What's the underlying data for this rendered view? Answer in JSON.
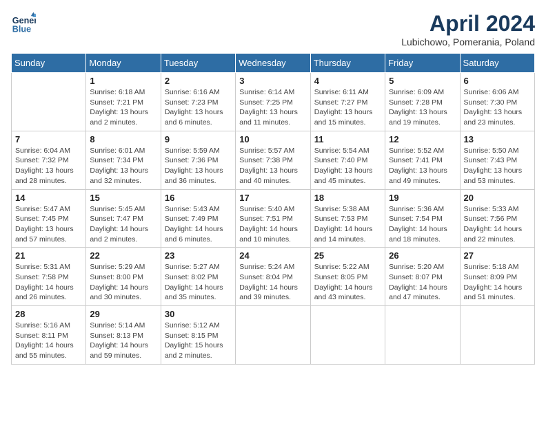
{
  "header": {
    "logo_line1": "General",
    "logo_line2": "Blue",
    "title": "April 2024",
    "location": "Lubichowo, Pomerania, Poland"
  },
  "weekdays": [
    "Sunday",
    "Monday",
    "Tuesday",
    "Wednesday",
    "Thursday",
    "Friday",
    "Saturday"
  ],
  "weeks": [
    [
      {
        "day": "",
        "info": ""
      },
      {
        "day": "1",
        "info": "Sunrise: 6:18 AM\nSunset: 7:21 PM\nDaylight: 13 hours\nand 2 minutes."
      },
      {
        "day": "2",
        "info": "Sunrise: 6:16 AM\nSunset: 7:23 PM\nDaylight: 13 hours\nand 6 minutes."
      },
      {
        "day": "3",
        "info": "Sunrise: 6:14 AM\nSunset: 7:25 PM\nDaylight: 13 hours\nand 11 minutes."
      },
      {
        "day": "4",
        "info": "Sunrise: 6:11 AM\nSunset: 7:27 PM\nDaylight: 13 hours\nand 15 minutes."
      },
      {
        "day": "5",
        "info": "Sunrise: 6:09 AM\nSunset: 7:28 PM\nDaylight: 13 hours\nand 19 minutes."
      },
      {
        "day": "6",
        "info": "Sunrise: 6:06 AM\nSunset: 7:30 PM\nDaylight: 13 hours\nand 23 minutes."
      }
    ],
    [
      {
        "day": "7",
        "info": "Sunrise: 6:04 AM\nSunset: 7:32 PM\nDaylight: 13 hours\nand 28 minutes."
      },
      {
        "day": "8",
        "info": "Sunrise: 6:01 AM\nSunset: 7:34 PM\nDaylight: 13 hours\nand 32 minutes."
      },
      {
        "day": "9",
        "info": "Sunrise: 5:59 AM\nSunset: 7:36 PM\nDaylight: 13 hours\nand 36 minutes."
      },
      {
        "day": "10",
        "info": "Sunrise: 5:57 AM\nSunset: 7:38 PM\nDaylight: 13 hours\nand 40 minutes."
      },
      {
        "day": "11",
        "info": "Sunrise: 5:54 AM\nSunset: 7:40 PM\nDaylight: 13 hours\nand 45 minutes."
      },
      {
        "day": "12",
        "info": "Sunrise: 5:52 AM\nSunset: 7:41 PM\nDaylight: 13 hours\nand 49 minutes."
      },
      {
        "day": "13",
        "info": "Sunrise: 5:50 AM\nSunset: 7:43 PM\nDaylight: 13 hours\nand 53 minutes."
      }
    ],
    [
      {
        "day": "14",
        "info": "Sunrise: 5:47 AM\nSunset: 7:45 PM\nDaylight: 13 hours\nand 57 minutes."
      },
      {
        "day": "15",
        "info": "Sunrise: 5:45 AM\nSunset: 7:47 PM\nDaylight: 14 hours\nand 2 minutes."
      },
      {
        "day": "16",
        "info": "Sunrise: 5:43 AM\nSunset: 7:49 PM\nDaylight: 14 hours\nand 6 minutes."
      },
      {
        "day": "17",
        "info": "Sunrise: 5:40 AM\nSunset: 7:51 PM\nDaylight: 14 hours\nand 10 minutes."
      },
      {
        "day": "18",
        "info": "Sunrise: 5:38 AM\nSunset: 7:53 PM\nDaylight: 14 hours\nand 14 minutes."
      },
      {
        "day": "19",
        "info": "Sunrise: 5:36 AM\nSunset: 7:54 PM\nDaylight: 14 hours\nand 18 minutes."
      },
      {
        "day": "20",
        "info": "Sunrise: 5:33 AM\nSunset: 7:56 PM\nDaylight: 14 hours\nand 22 minutes."
      }
    ],
    [
      {
        "day": "21",
        "info": "Sunrise: 5:31 AM\nSunset: 7:58 PM\nDaylight: 14 hours\nand 26 minutes."
      },
      {
        "day": "22",
        "info": "Sunrise: 5:29 AM\nSunset: 8:00 PM\nDaylight: 14 hours\nand 30 minutes."
      },
      {
        "day": "23",
        "info": "Sunrise: 5:27 AM\nSunset: 8:02 PM\nDaylight: 14 hours\nand 35 minutes."
      },
      {
        "day": "24",
        "info": "Sunrise: 5:24 AM\nSunset: 8:04 PM\nDaylight: 14 hours\nand 39 minutes."
      },
      {
        "day": "25",
        "info": "Sunrise: 5:22 AM\nSunset: 8:05 PM\nDaylight: 14 hours\nand 43 minutes."
      },
      {
        "day": "26",
        "info": "Sunrise: 5:20 AM\nSunset: 8:07 PM\nDaylight: 14 hours\nand 47 minutes."
      },
      {
        "day": "27",
        "info": "Sunrise: 5:18 AM\nSunset: 8:09 PM\nDaylight: 14 hours\nand 51 minutes."
      }
    ],
    [
      {
        "day": "28",
        "info": "Sunrise: 5:16 AM\nSunset: 8:11 PM\nDaylight: 14 hours\nand 55 minutes."
      },
      {
        "day": "29",
        "info": "Sunrise: 5:14 AM\nSunset: 8:13 PM\nDaylight: 14 hours\nand 59 minutes."
      },
      {
        "day": "30",
        "info": "Sunrise: 5:12 AM\nSunset: 8:15 PM\nDaylight: 15 hours\nand 2 minutes."
      },
      {
        "day": "",
        "info": ""
      },
      {
        "day": "",
        "info": ""
      },
      {
        "day": "",
        "info": ""
      },
      {
        "day": "",
        "info": ""
      }
    ]
  ]
}
